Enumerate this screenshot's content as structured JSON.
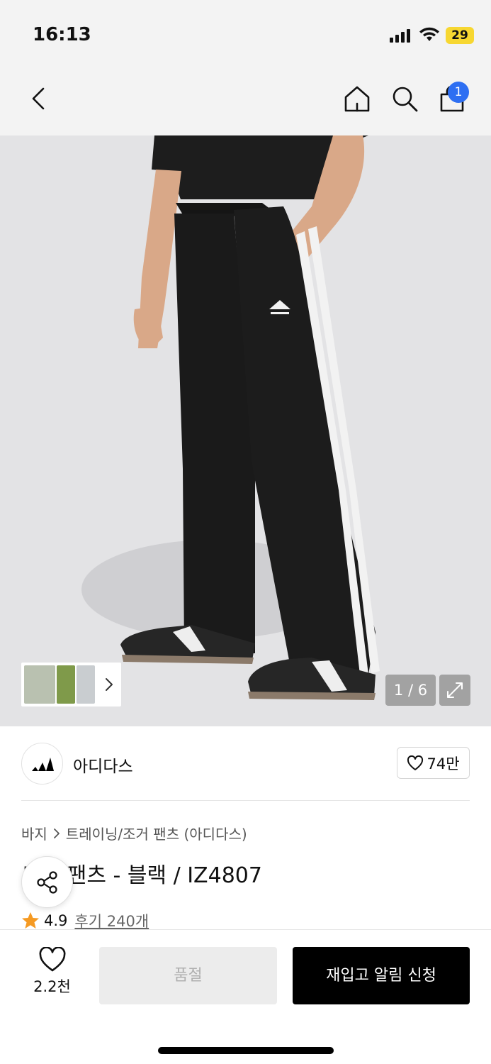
{
  "status_bar": {
    "time": "16:13",
    "battery": "29"
  },
  "header": {
    "cart_count": "1"
  },
  "gallery": {
    "counter": "1 / 6"
  },
  "brand": {
    "name": "아디다스",
    "likes": "74만"
  },
  "breadcrumb": {
    "items": [
      "바지",
      "트레이닝/조거 팬츠 (아디다스)"
    ]
  },
  "product": {
    "title": "트랙 팬츠 - 블랙 / IZ4807",
    "rating": "4.9",
    "reviews": "후기 240개"
  },
  "bottom_bar": {
    "wish_count": "2.2천",
    "soldout_label": "품절",
    "restock_label": "재입고 알림 신청"
  },
  "colors": {
    "accent_blue": "#2e6ff2",
    "star": "#f59a23",
    "black": "#000000"
  },
  "icons": [
    "back-icon",
    "home-icon",
    "search-icon",
    "bag-icon",
    "chevron-right-icon",
    "expand-icon",
    "heart-icon",
    "share-icon",
    "star-icon"
  ]
}
